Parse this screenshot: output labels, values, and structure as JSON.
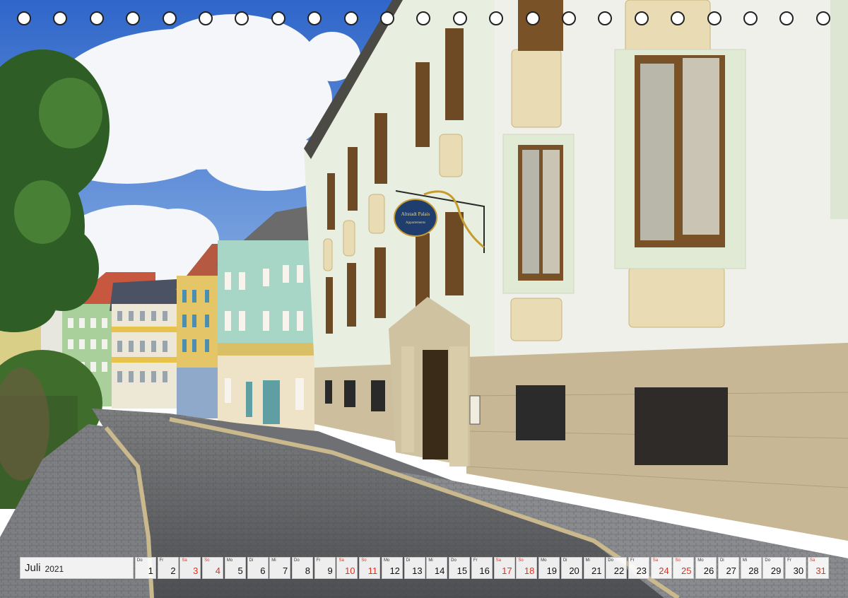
{
  "calendar": {
    "month": "Juli",
    "year": "2021",
    "highlight_color": "#e0301e",
    "days": [
      {
        "wd": "Do",
        "n": "1",
        "hl": false
      },
      {
        "wd": "Fr",
        "n": "2",
        "hl": false
      },
      {
        "wd": "Sa",
        "n": "3",
        "hl": true
      },
      {
        "wd": "So",
        "n": "4",
        "hl": true
      },
      {
        "wd": "Mo",
        "n": "5",
        "hl": false
      },
      {
        "wd": "Di",
        "n": "6",
        "hl": false
      },
      {
        "wd": "Mi",
        "n": "7",
        "hl": false
      },
      {
        "wd": "Do",
        "n": "8",
        "hl": false
      },
      {
        "wd": "Fr",
        "n": "9",
        "hl": false
      },
      {
        "wd": "Sa",
        "n": "10",
        "hl": true
      },
      {
        "wd": "So",
        "n": "11",
        "hl": true
      },
      {
        "wd": "Mo",
        "n": "12",
        "hl": false
      },
      {
        "wd": "Di",
        "n": "13",
        "hl": false
      },
      {
        "wd": "Mi",
        "n": "14",
        "hl": false
      },
      {
        "wd": "Do",
        "n": "15",
        "hl": false
      },
      {
        "wd": "Fr",
        "n": "16",
        "hl": false
      },
      {
        "wd": "Sa",
        "n": "17",
        "hl": true
      },
      {
        "wd": "So",
        "n": "18",
        "hl": true
      },
      {
        "wd": "Mo",
        "n": "19",
        "hl": false
      },
      {
        "wd": "Di",
        "n": "20",
        "hl": false
      },
      {
        "wd": "Mi",
        "n": "21",
        "hl": false
      },
      {
        "wd": "Do",
        "n": "22",
        "hl": false
      },
      {
        "wd": "Fr",
        "n": "23",
        "hl": false
      },
      {
        "wd": "Sa",
        "n": "24",
        "hl": true
      },
      {
        "wd": "So",
        "n": "25",
        "hl": true
      },
      {
        "wd": "Mo",
        "n": "26",
        "hl": false
      },
      {
        "wd": "Di",
        "n": "27",
        "hl": false
      },
      {
        "wd": "Mi",
        "n": "28",
        "hl": false
      },
      {
        "wd": "Do",
        "n": "29",
        "hl": false
      },
      {
        "wd": "Fr",
        "n": "30",
        "hl": false
      },
      {
        "wd": "Sa",
        "n": "31",
        "hl": true
      }
    ]
  },
  "sign": {
    "line1": "Altstadt Palais",
    "line2": "Appartements"
  }
}
